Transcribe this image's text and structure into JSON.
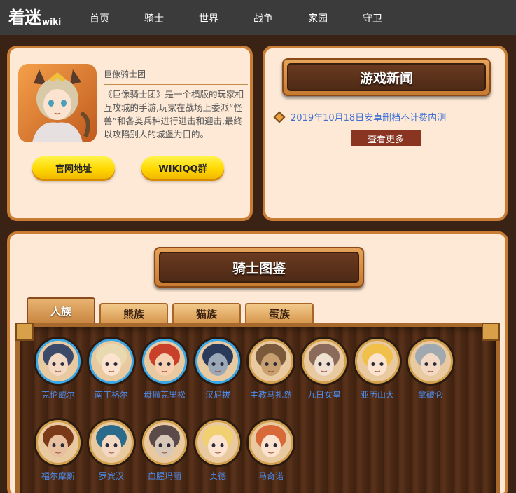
{
  "header": {
    "logo_main": "着迷",
    "logo_sub": "wiki",
    "nav": [
      "首页",
      "骑士",
      "世界",
      "战争",
      "家园",
      "守卫"
    ]
  },
  "intro": {
    "game_name": "巨像骑士团",
    "description": "《巨像骑士团》是一个横版的玩家相互攻城的手游,玩家在战场上委派“怪兽”和各类兵种进行进击和迎击,最终以攻陷别人的城堡为目的。",
    "official_button": "官网地址",
    "qq_button": "WIKIQQ群"
  },
  "news": {
    "title": "游戏新闻",
    "items": [
      "2019年10月18日安卓删档不计费内测"
    ],
    "more_button": "查看更多"
  },
  "knights": {
    "title": "骑士图鉴",
    "tabs": [
      "人族",
      "熊族",
      "猫族",
      "蛋族"
    ],
    "active_tab": "人族",
    "row1": [
      {
        "name": "克伦威尔",
        "ring": "blue"
      },
      {
        "name": "南丁格尔",
        "ring": "blue"
      },
      {
        "name": "母狮克里松",
        "ring": "blue"
      },
      {
        "name": "汉尼拔",
        "ring": "blue"
      },
      {
        "name": "主教马扎然",
        "ring": "gold"
      },
      {
        "name": "九日女皇",
        "ring": "gold"
      },
      {
        "name": "亚历山大",
        "ring": "gold"
      },
      {
        "name": "拿破仑",
        "ring": "gold"
      }
    ],
    "row2": [
      {
        "name": "福尔摩斯",
        "ring": "gold"
      },
      {
        "name": "罗宾汉",
        "ring": "gold"
      },
      {
        "name": "血腥玛丽",
        "ring": "gold"
      },
      {
        "name": "贞德",
        "ring": "gold"
      },
      {
        "name": "马奇诺",
        "ring": "gold"
      }
    ]
  },
  "colors": {
    "accent_orange": "#c97c34",
    "panel_bg": "#fde9d6",
    "link_blue": "#4b8df0",
    "more_red": "#8a3422"
  }
}
